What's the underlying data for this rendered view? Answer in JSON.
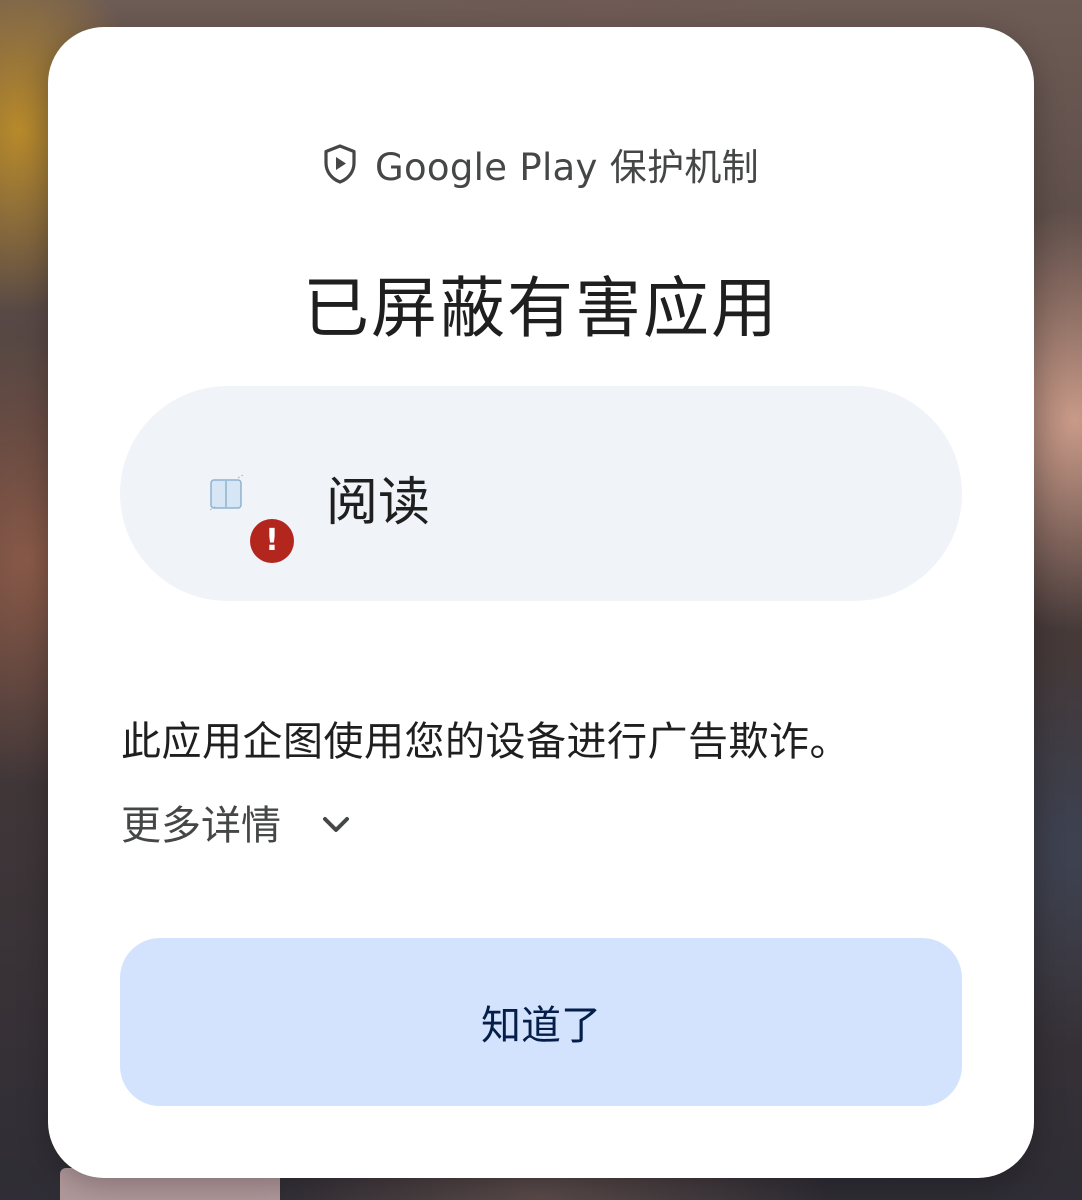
{
  "header": {
    "icon": "play-protect-shield-icon",
    "text": "Google Play 保护机制"
  },
  "dialog": {
    "title": "已屏蔽有害应用",
    "app": {
      "name": "阅读",
      "icon": "book-icon",
      "badge_icon": "error-icon",
      "badge_symbol": "!"
    },
    "description": "此应用企图使用您的设备进行广告欺诈。",
    "more_details": {
      "label": "更多详情",
      "icon": "chevron-down-icon"
    },
    "confirm_label": "知道了"
  },
  "colors": {
    "dialog_bg": "#ffffff",
    "card_bg": "#f0f4f9",
    "button_bg": "#d3e3fd",
    "button_text": "#041e49",
    "error": "#b3261e",
    "text_primary": "#1f1f1f",
    "text_secondary": "#444746"
  }
}
